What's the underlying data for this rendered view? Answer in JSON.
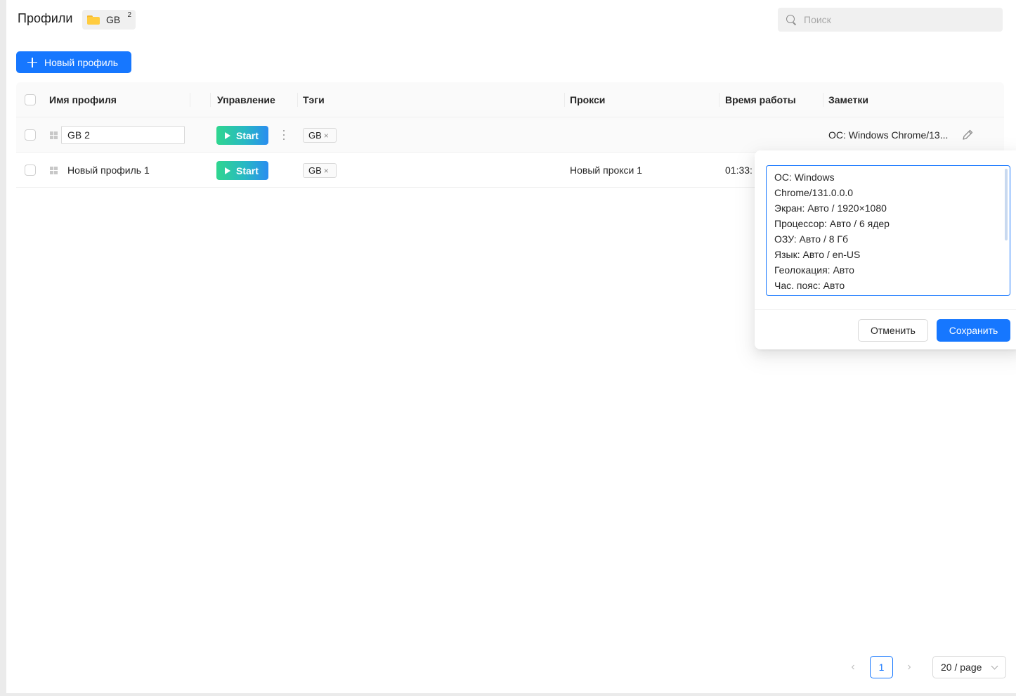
{
  "header": {
    "title": "Профили",
    "folder": {
      "name": "GB",
      "count": "2"
    },
    "search_placeholder": "Поиск"
  },
  "toolbar": {
    "new_profile_label": "Новый профиль"
  },
  "table": {
    "columns": [
      "Имя профиля",
      "Управление",
      "Тэги",
      "Прокси",
      "Время работы",
      "Заметки"
    ],
    "start_label": "Start",
    "rows": [
      {
        "name": "GB 2",
        "tag": "GB",
        "proxy": "",
        "uptime": "",
        "notes": "ОС: Windows Chrome/13..."
      },
      {
        "name": "Новый профиль 1",
        "tag": "GB",
        "proxy": "Новый прокси 1",
        "uptime": "01:33:",
        "notes": ""
      }
    ]
  },
  "notes_editor": {
    "lines": [
      "ОС: Windows",
      "Chrome/131.0.0.0",
      "Экран: Авто / 1920×1080",
      "Процессор: Авто / 6 ядер",
      "ОЗУ: Авто / 8 Гб",
      "Язык: Авто / en-US",
      "Геолокация: Авто",
      "Час. пояс: Авто"
    ],
    "cancel_label": "Отменить",
    "save_label": "Сохранить"
  },
  "pagination": {
    "current_page": "1",
    "page_size_label": "20 / page"
  },
  "colors": {
    "primary": "#1677ff",
    "start_gradient_from": "#2fd68f",
    "start_gradient_to": "#2a8df0",
    "folder": "#ffcc3f"
  }
}
